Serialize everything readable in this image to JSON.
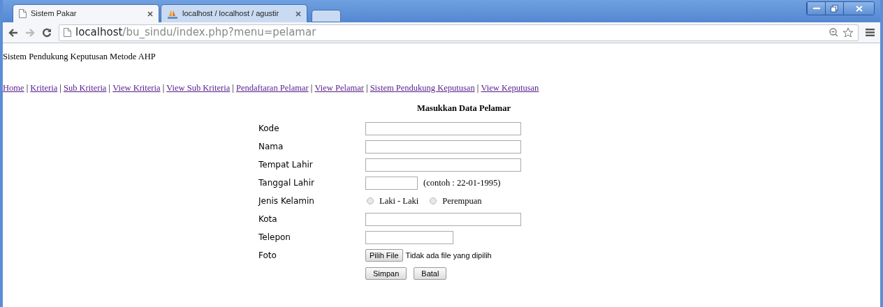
{
  "browser": {
    "tabs": [
      {
        "title": "Sistem Pakar",
        "selected": true,
        "kind": "page"
      },
      {
        "title": "localhost / localhost / agustir",
        "selected": false,
        "kind": "app"
      }
    ],
    "url_host": "localhost",
    "url_path": "/bu_sindu/index.php?menu=pelamar"
  },
  "page": {
    "site_title": "Sistem Pendukung Keputusan Metode AHP",
    "nav_links": [
      "Home",
      "Kriteria",
      "Sub Kriteria",
      "View Kriteria",
      "View Sub Kriteria",
      "Pendaftaran Pelamar",
      "View Pelamar",
      "Sistem Pendukung Keputusan",
      "View Keputusan"
    ],
    "nav_separator": "|",
    "form_title": "Masukkan Data Pelamar",
    "fields": [
      {
        "label": "Kode",
        "kind": "text"
      },
      {
        "label": "Nama",
        "kind": "text"
      },
      {
        "label": "Tempat Lahir",
        "kind": "text"
      },
      {
        "label": "Tanggal Lahir",
        "kind": "date",
        "hint": "(contoh : 22-01-1995)"
      },
      {
        "label": "Jenis Kelamin",
        "kind": "radio",
        "options": [
          {
            "label": "Laki - Laki",
            "selected": false
          },
          {
            "label": "Perempuan",
            "selected": false
          }
        ]
      },
      {
        "label": "Kota",
        "kind": "text"
      },
      {
        "label": "Telepon",
        "kind": "phone"
      },
      {
        "label": "Foto",
        "kind": "file",
        "button": "Pilih File",
        "status": "Tidak ada file yang dipilih"
      }
    ],
    "buttons": [
      "Simpan",
      "Batal"
    ]
  }
}
